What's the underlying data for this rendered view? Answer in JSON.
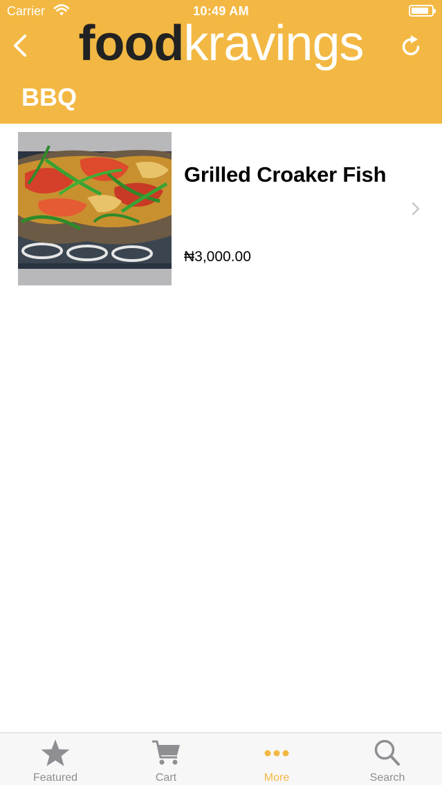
{
  "status_bar": {
    "carrier": "Carrier",
    "time": "10:49 AM"
  },
  "header": {
    "logo_part1": "food",
    "logo_part2": "kravings",
    "title": "BBQ"
  },
  "colors": {
    "accent": "#F3B843",
    "logo_dark": "#222222",
    "tab_inactive": "#8e8e93"
  },
  "items": [
    {
      "name": "Grilled Croaker Fish",
      "price": "₦3,000.00"
    }
  ],
  "tab_bar": {
    "tabs": [
      {
        "label": "Featured",
        "icon": "star-icon",
        "active": false
      },
      {
        "label": "Cart",
        "icon": "cart-icon",
        "active": false
      },
      {
        "label": "More",
        "icon": "more-icon",
        "active": true
      },
      {
        "label": "Search",
        "icon": "search-icon",
        "active": false
      }
    ]
  }
}
